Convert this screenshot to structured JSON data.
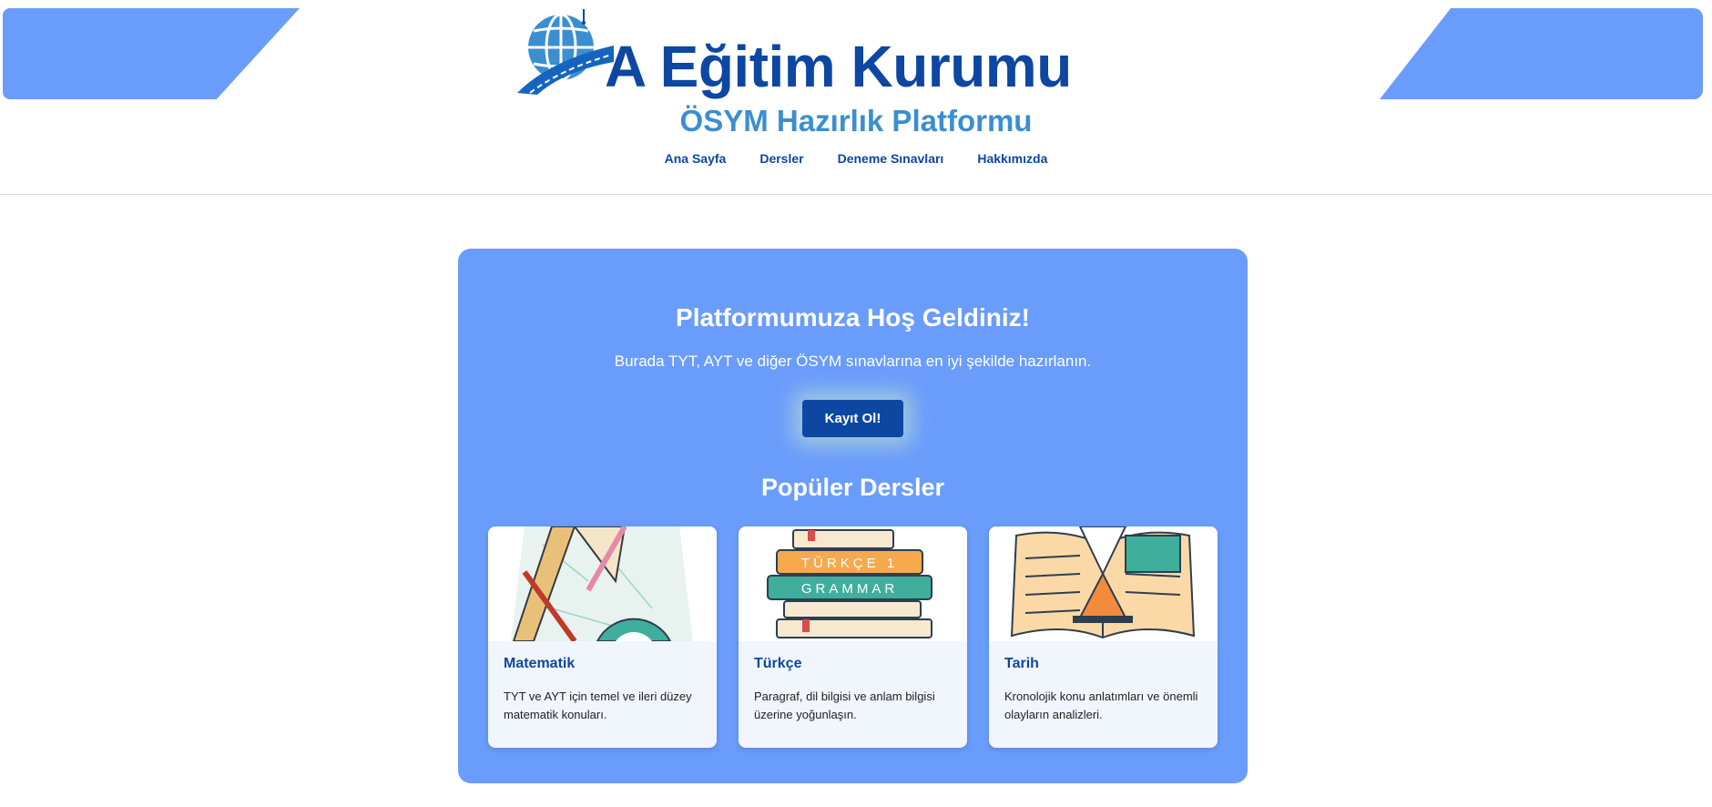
{
  "header": {
    "logo_text": "A Eğitim Kurumu",
    "subtitle": "ÖSYM Hazırlık Platformu",
    "nav": [
      "Ana Sayfa",
      "Dersler",
      "Deneme Sınavları",
      "Hakkımızda"
    ]
  },
  "hero": {
    "welcome_title": "Platformumuza Hoş Geldiniz!",
    "intro_text": "Burada TYT, AYT ve diğer ÖSYM sınavlarına en iyi şekilde hazırlanın.",
    "cta_label": "Kayıt Ol!",
    "popular_title": "Popüler Dersler"
  },
  "courses": [
    {
      "title": "Matematik",
      "description": "TYT ve AYT için temel ve ileri düzey matematik konuları.",
      "image_icon": "geometry-tools-icon"
    },
    {
      "title": "Türkçe",
      "description": "Paragraf, dil bilgisi ve anlam bilgisi üzerine yoğunlaşın.",
      "image_icon": "books-stack-icon",
      "book_labels": [
        "TÜRKÇE 1",
        "GRAMMAR"
      ]
    },
    {
      "title": "Tarih",
      "description": "Kronolojik konu anlatımları ve önemli olayların analizleri.",
      "image_icon": "hourglass-book-icon"
    }
  ],
  "colors": {
    "primary_blue": "#6a9cfc",
    "dark_blue": "#0d47a1",
    "subtitle_blue": "#3b8ed0",
    "card_bg": "#f1f6fd"
  }
}
